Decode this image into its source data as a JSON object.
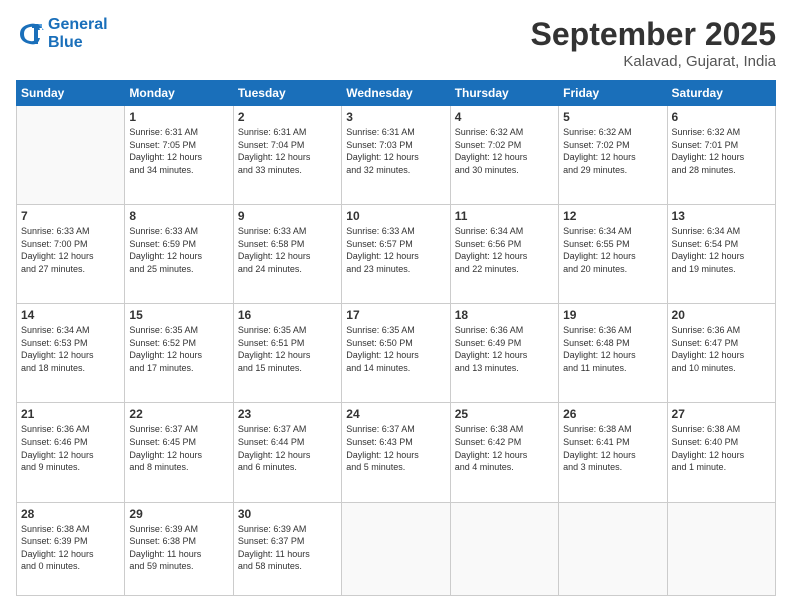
{
  "logo": {
    "line1": "General",
    "line2": "Blue"
  },
  "title": "September 2025",
  "subtitle": "Kalavad, Gujarat, India",
  "weekdays": [
    "Sunday",
    "Monday",
    "Tuesday",
    "Wednesday",
    "Thursday",
    "Friday",
    "Saturday"
  ],
  "weeks": [
    [
      {
        "day": "",
        "info": ""
      },
      {
        "day": "1",
        "info": "Sunrise: 6:31 AM\nSunset: 7:05 PM\nDaylight: 12 hours\nand 34 minutes."
      },
      {
        "day": "2",
        "info": "Sunrise: 6:31 AM\nSunset: 7:04 PM\nDaylight: 12 hours\nand 33 minutes."
      },
      {
        "day": "3",
        "info": "Sunrise: 6:31 AM\nSunset: 7:03 PM\nDaylight: 12 hours\nand 32 minutes."
      },
      {
        "day": "4",
        "info": "Sunrise: 6:32 AM\nSunset: 7:02 PM\nDaylight: 12 hours\nand 30 minutes."
      },
      {
        "day": "5",
        "info": "Sunrise: 6:32 AM\nSunset: 7:02 PM\nDaylight: 12 hours\nand 29 minutes."
      },
      {
        "day": "6",
        "info": "Sunrise: 6:32 AM\nSunset: 7:01 PM\nDaylight: 12 hours\nand 28 minutes."
      }
    ],
    [
      {
        "day": "7",
        "info": "Sunrise: 6:33 AM\nSunset: 7:00 PM\nDaylight: 12 hours\nand 27 minutes."
      },
      {
        "day": "8",
        "info": "Sunrise: 6:33 AM\nSunset: 6:59 PM\nDaylight: 12 hours\nand 25 minutes."
      },
      {
        "day": "9",
        "info": "Sunrise: 6:33 AM\nSunset: 6:58 PM\nDaylight: 12 hours\nand 24 minutes."
      },
      {
        "day": "10",
        "info": "Sunrise: 6:33 AM\nSunset: 6:57 PM\nDaylight: 12 hours\nand 23 minutes."
      },
      {
        "day": "11",
        "info": "Sunrise: 6:34 AM\nSunset: 6:56 PM\nDaylight: 12 hours\nand 22 minutes."
      },
      {
        "day": "12",
        "info": "Sunrise: 6:34 AM\nSunset: 6:55 PM\nDaylight: 12 hours\nand 20 minutes."
      },
      {
        "day": "13",
        "info": "Sunrise: 6:34 AM\nSunset: 6:54 PM\nDaylight: 12 hours\nand 19 minutes."
      }
    ],
    [
      {
        "day": "14",
        "info": "Sunrise: 6:34 AM\nSunset: 6:53 PM\nDaylight: 12 hours\nand 18 minutes."
      },
      {
        "day": "15",
        "info": "Sunrise: 6:35 AM\nSunset: 6:52 PM\nDaylight: 12 hours\nand 17 minutes."
      },
      {
        "day": "16",
        "info": "Sunrise: 6:35 AM\nSunset: 6:51 PM\nDaylight: 12 hours\nand 15 minutes."
      },
      {
        "day": "17",
        "info": "Sunrise: 6:35 AM\nSunset: 6:50 PM\nDaylight: 12 hours\nand 14 minutes."
      },
      {
        "day": "18",
        "info": "Sunrise: 6:36 AM\nSunset: 6:49 PM\nDaylight: 12 hours\nand 13 minutes."
      },
      {
        "day": "19",
        "info": "Sunrise: 6:36 AM\nSunset: 6:48 PM\nDaylight: 12 hours\nand 11 minutes."
      },
      {
        "day": "20",
        "info": "Sunrise: 6:36 AM\nSunset: 6:47 PM\nDaylight: 12 hours\nand 10 minutes."
      }
    ],
    [
      {
        "day": "21",
        "info": "Sunrise: 6:36 AM\nSunset: 6:46 PM\nDaylight: 12 hours\nand 9 minutes."
      },
      {
        "day": "22",
        "info": "Sunrise: 6:37 AM\nSunset: 6:45 PM\nDaylight: 12 hours\nand 8 minutes."
      },
      {
        "day": "23",
        "info": "Sunrise: 6:37 AM\nSunset: 6:44 PM\nDaylight: 12 hours\nand 6 minutes."
      },
      {
        "day": "24",
        "info": "Sunrise: 6:37 AM\nSunset: 6:43 PM\nDaylight: 12 hours\nand 5 minutes."
      },
      {
        "day": "25",
        "info": "Sunrise: 6:38 AM\nSunset: 6:42 PM\nDaylight: 12 hours\nand 4 minutes."
      },
      {
        "day": "26",
        "info": "Sunrise: 6:38 AM\nSunset: 6:41 PM\nDaylight: 12 hours\nand 3 minutes."
      },
      {
        "day": "27",
        "info": "Sunrise: 6:38 AM\nSunset: 6:40 PM\nDaylight: 12 hours\nand 1 minute."
      }
    ],
    [
      {
        "day": "28",
        "info": "Sunrise: 6:38 AM\nSunset: 6:39 PM\nDaylight: 12 hours\nand 0 minutes."
      },
      {
        "day": "29",
        "info": "Sunrise: 6:39 AM\nSunset: 6:38 PM\nDaylight: 11 hours\nand 59 minutes."
      },
      {
        "day": "30",
        "info": "Sunrise: 6:39 AM\nSunset: 6:37 PM\nDaylight: 11 hours\nand 58 minutes."
      },
      {
        "day": "",
        "info": ""
      },
      {
        "day": "",
        "info": ""
      },
      {
        "day": "",
        "info": ""
      },
      {
        "day": "",
        "info": ""
      }
    ]
  ]
}
